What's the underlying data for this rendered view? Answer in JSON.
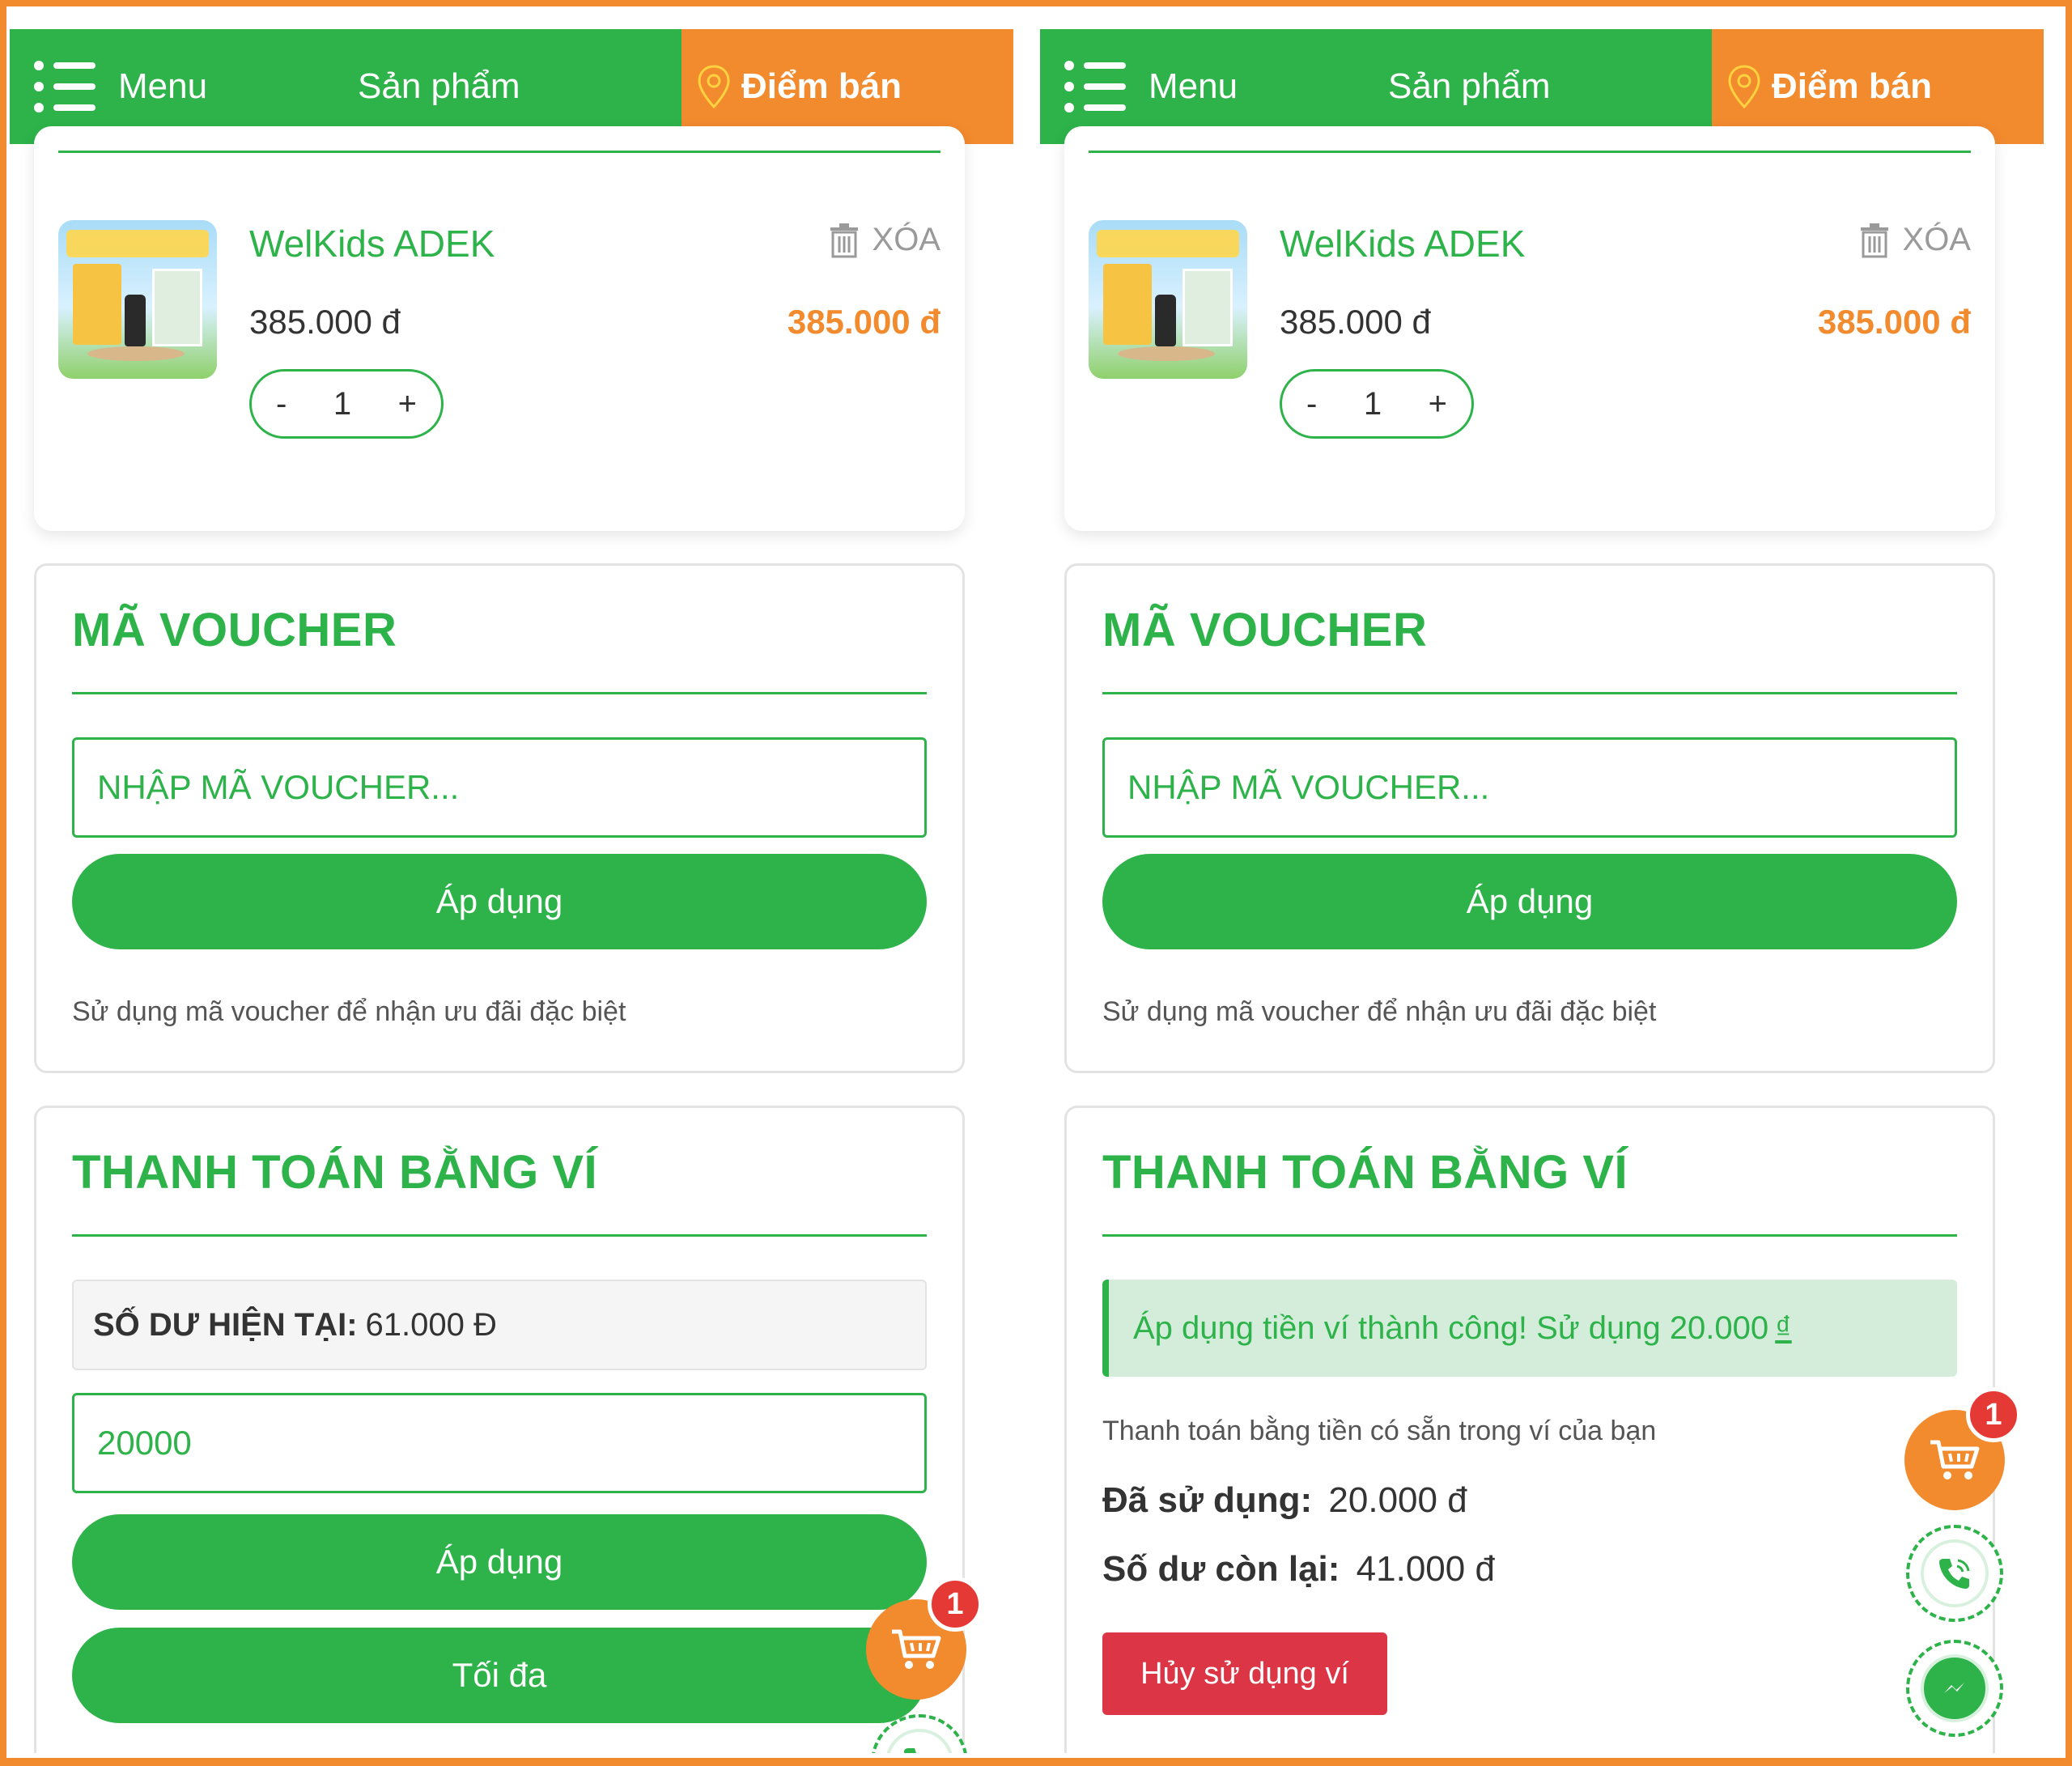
{
  "colors": {
    "brand_green": "#2db34a",
    "accent_orange": "#f28a2e",
    "danger_red": "#dc3545",
    "badge_red": "#e53935",
    "success_bg": "#d4edda"
  },
  "nav": {
    "menu_label": "Menu",
    "products_label": "Sản phẩm",
    "stores_label": "Điểm bán",
    "menu_icon": "hamburger-icon",
    "stores_icon": "location-pin-icon"
  },
  "cart_item": {
    "name": "WelKids ADEK",
    "delete_label": "XÓA",
    "unit_price": "385.000 đ",
    "line_total": "385.000 đ",
    "qty_minus": "-",
    "quantity": "1",
    "qty_plus": "+"
  },
  "voucher": {
    "title": "MÃ VOUCHER",
    "placeholder": "NHẬP MÃ VOUCHER...",
    "apply_label": "Áp dụng",
    "hint": "Sử dụng mã voucher để nhận ưu đãi đặc biệt"
  },
  "wallet_before": {
    "title": "THANH TOÁN BẰNG VÍ",
    "balance_label": "SỐ DƯ HIỆN TẠI:",
    "balance_value": "61.000 Đ",
    "amount_value": "20000",
    "apply_label": "Áp dụng",
    "max_label": "Tối đa"
  },
  "wallet_after": {
    "title": "THANH TOÁN BẰNG VÍ",
    "success_text": "Áp dụng tiền ví thành công! Sử dụng 20.000",
    "success_currency": "₫",
    "description": "Thanh toán bằng tiền có sẵn trong ví của bạn",
    "used_label": "Đã sử dụng:",
    "used_value": "20.000 đ",
    "remaining_label": "Số dư còn lại:",
    "remaining_value": "41.000 đ",
    "cancel_label": "Hủy sử dụng ví"
  },
  "floating": {
    "cart_badge": "1",
    "cart_icon": "cart-icon",
    "phone_icon": "phone-icon",
    "messenger_icon": "messenger-icon"
  }
}
